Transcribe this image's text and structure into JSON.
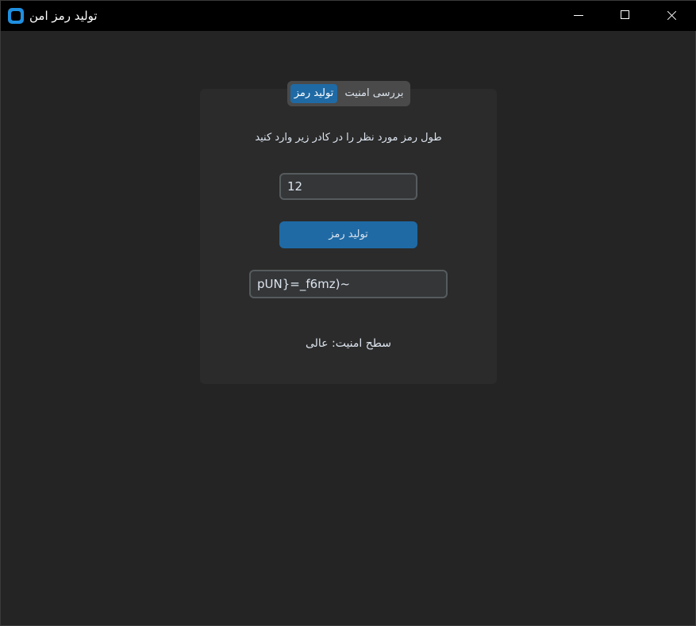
{
  "window": {
    "title": "تولید رمز امن",
    "icon": "app-icon"
  },
  "tabs": [
    {
      "label": "تولید رمز",
      "active": true
    },
    {
      "label": "بررسی امنیت",
      "active": false
    }
  ],
  "generator": {
    "prompt": "طول رمز مورد نظر را در کادر زیر وارد کنید",
    "length_value": "12",
    "generate_button": "تولید رمز",
    "password_value": "pUN}=_f6mz)~",
    "strength_text": "سطح امنیت: عالی"
  },
  "colors": {
    "accent": "#1f6aa5",
    "background": "#242424",
    "panel": "#2b2b2b"
  }
}
